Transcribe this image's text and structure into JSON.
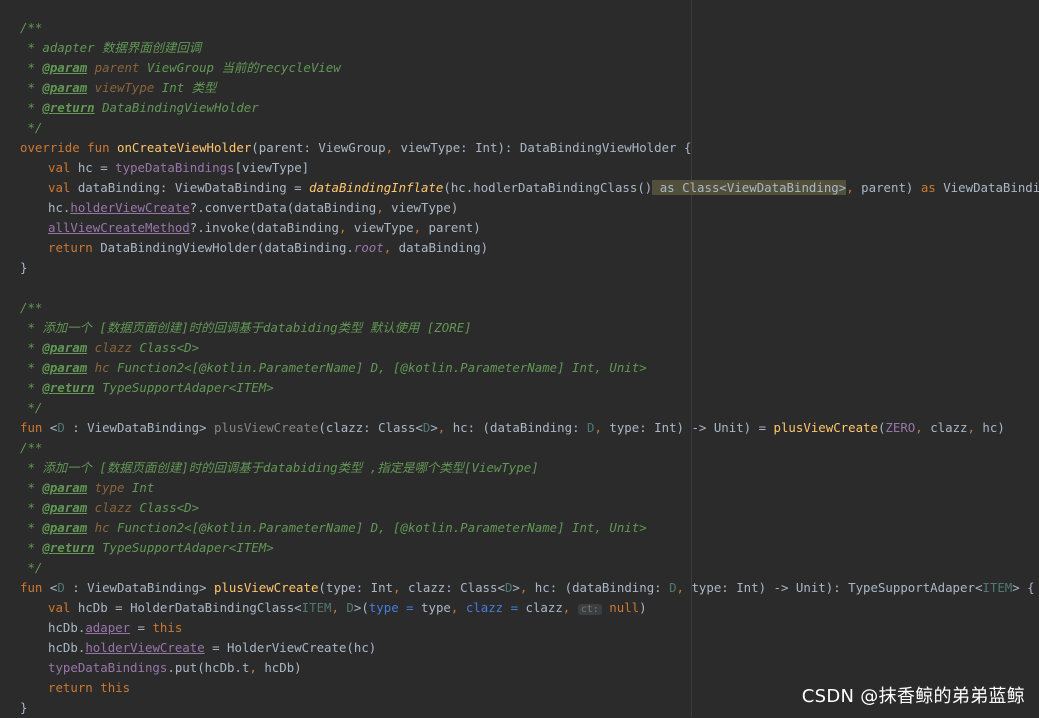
{
  "lines": [
    "/**",
    " * adapter 数据界面创建回调",
    " * @param parent ViewGroup 当前的recycleView",
    " * @param viewType Int 类型",
    " * @return DataBindingViewHolder",
    " */",
    "override fun onCreateViewHolder(parent: ViewGroup, viewType: Int): DataBindingViewHolder {",
    "val hc = typeDataBindings[viewType]",
    "val dataBinding: ViewDataBinding = dataBindingInflate(hc.hodlerDataBindingClass() as Class<ViewDataBinding>, parent) as ViewDataBinding",
    "hc.holderViewCreate?.convertData(dataBinding, viewType)",
    "allViewCreateMethod?.invoke(dataBinding, viewType, parent)",
    "return DataBindingViewHolder(dataBinding.root, dataBinding)",
    "}",
    "",
    "/**",
    " * 添加一个 [数据页面创建]时的回调基于databiding类型 默认使用 [ZORE]",
    " * @param clazz Class<D>",
    " * @param hc Function2<[@kotlin.ParameterName] D, [@kotlin.ParameterName] Int, Unit>",
    " * @return TypeSupportAdaper<ITEM>",
    " */",
    "fun <D : ViewDataBinding> plusViewCreate(clazz: Class<D>, hc: (dataBinding: D, type: Int) -> Unit) = plusViewCreate(ZERO, clazz, hc)",
    "/**",
    " * 添加一个 [数据页面创建]时的回调基于databiding类型 ,指定是哪个类型[ViewType]",
    " * @param type Int",
    " * @param clazz Class<D>",
    " * @param hc Function2<[@kotlin.ParameterName] D, [@kotlin.ParameterName] Int, Unit>",
    " * @return TypeSupportAdaper<ITEM>",
    " */",
    "fun <D : ViewDataBinding> plusViewCreate(type: Int, clazz: Class<D>, hc: (dataBinding: D, type: Int) -> Unit): TypeSupportAdaper<ITEM> {",
    "val hcDb = HolderDataBindingClass<ITEM, D>(type = type, clazz = clazz, ct: null)",
    "hcDb.adaper = this",
    "hcDb.holderViewCreate = HolderViewCreate(hc)",
    "typeDataBindings.put(hcDb.t, hcDb)",
    "return this",
    "}"
  ],
  "watermark": "CSDN @抹香鲸的弟弟蓝鲸",
  "colors": {
    "background": "#2b2b2b",
    "keyword": "#cc7832",
    "function": "#ffc66d",
    "comment": "#629755",
    "property": "#9876aa",
    "text": "#a9b7c6",
    "type_param": "#507874",
    "named_arg": "#467cda"
  }
}
